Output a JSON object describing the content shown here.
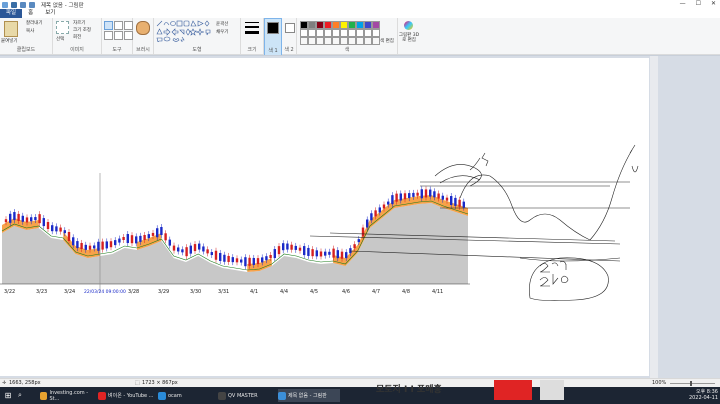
{
  "title_bar": {
    "title": "제목 없음 - 그림판",
    "minimize": "—",
    "maximize": "☐",
    "close": "✕"
  },
  "tabs": [
    {
      "label": "파일",
      "active": true
    },
    {
      "label": "홈",
      "active": false
    },
    {
      "label": "보기",
      "active": false
    }
  ],
  "ribbon": {
    "clipboard": {
      "paste": "붙여넣기",
      "cut": "잘라내기",
      "copy": "복사",
      "label": "클립보드"
    },
    "image": {
      "select": "선택",
      "crop": "자르기",
      "resize": "크기 조정",
      "rotate": "회전",
      "label": "이미지"
    },
    "tools": {
      "label": "도구"
    },
    "brush": {
      "label": "브러시"
    },
    "shapes": {
      "outline": "윤곽선",
      "fill": "채우기",
      "label": "도형"
    },
    "size": {
      "label": "크기"
    },
    "color1": {
      "label": "색 1"
    },
    "color2": {
      "label": "색 2"
    },
    "colors": {
      "label": "색",
      "edit": "색 편집",
      "paint3d": "그림판 3D로 편집"
    },
    "palette": [
      "#000000",
      "#7f7f7f",
      "#880015",
      "#ed1c24",
      "#ff7f27",
      "#fff200",
      "#22b14c",
      "#00a2e8",
      "#3f48cc",
      "#a349a4"
    ]
  },
  "chart_data": {
    "type": "candlestick",
    "categories": [
      "3/22",
      "3/23",
      "3/24",
      "22/03/24 09:00:00",
      "3/28",
      "3/29",
      "3/30",
      "3/31",
      "4/1",
      "4/4",
      "4/5",
      "4/6",
      "4/7",
      "4/8",
      "4/11"
    ],
    "colors": {
      "up": "#d62020",
      "down": "#1a2ac8",
      "area_fill": "#f7a24a",
      "base_fill": "#c8c8c8",
      "ma_line": "#1a7a1a"
    }
  },
  "status_bar": {
    "position": "1663, 258px",
    "size": "1723 × 867px",
    "zoom": "100%"
  },
  "taskbar": {
    "items": [
      {
        "label": "Investing.com - St...",
        "color": "#e8a330"
      },
      {
        "label": "벼이온 - YouTube ...",
        "color": "#e02424"
      },
      {
        "label": "ocam",
        "color": "#2a8bd8"
      },
      {
        "label": "QV MASTER",
        "color": "#444"
      },
      {
        "label": "제목 없음 - 그림판",
        "color": "#3c8fd8"
      }
    ],
    "clock_time": "오후 8:36",
    "clock_date": "2022-04-11"
  },
  "ad_text": "모토지 I I 포메홍"
}
